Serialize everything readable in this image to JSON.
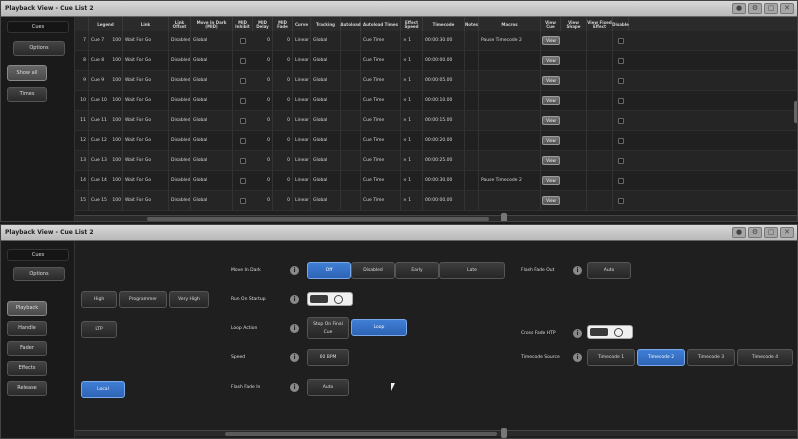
{
  "top_window": {
    "title": "Playback View - Cue List 2",
    "nav": {
      "cues": "Cues",
      "options": "Options",
      "show_all": "Show all",
      "times": "Times"
    },
    "columns": [
      "",
      "Legend",
      "Link",
      "Link Offset",
      "Move In Dark (MID)",
      "MID Inhibit",
      "MID Delay",
      "MID Fade",
      "Curve",
      "Tracking",
      "Autoload",
      "Autoload Times",
      "Effect Speed",
      "Timecode",
      "Notes",
      "Macros",
      "View Cue",
      "View Shape",
      "View Fixed Effect",
      "Disable"
    ],
    "rows": [
      {
        "n": "7",
        "legend": "Cue 7",
        "lvl": "100",
        "link": "Wait For Go",
        "offset": "Disabled",
        "mid": "Global",
        "delay": "0",
        "fade": "0",
        "curve": "Linear",
        "tracking": "Global",
        "autoload": "Cue Time",
        "speed": "× 1",
        "timecode": "00:00:30.00",
        "macros": "Pause Timecode 2",
        "view": "View"
      },
      {
        "n": "8",
        "legend": "Cue 8",
        "lvl": "100",
        "link": "Wait For Go",
        "offset": "Disabled",
        "mid": "Global",
        "delay": "0",
        "fade": "0",
        "curve": "Linear",
        "tracking": "Global",
        "autoload": "Cue Time",
        "speed": "× 1",
        "timecode": "00:00:00.00",
        "macros": "",
        "view": "View"
      },
      {
        "n": "9",
        "legend": "Cue 9",
        "lvl": "100",
        "link": "Wait For Go",
        "offset": "Disabled",
        "mid": "Global",
        "delay": "0",
        "fade": "0",
        "curve": "Linear",
        "tracking": "Global",
        "autoload": "Cue Time",
        "speed": "× 1",
        "timecode": "00:00:05.00",
        "macros": "",
        "view": "View"
      },
      {
        "n": "10",
        "legend": "Cue 10",
        "lvl": "100",
        "link": "Wait For Go",
        "offset": "Disabled",
        "mid": "Global",
        "delay": "0",
        "fade": "0",
        "curve": "Linear",
        "tracking": "Global",
        "autoload": "Cue Time",
        "speed": "× 1",
        "timecode": "00:00:10.00",
        "macros": "",
        "view": "View"
      },
      {
        "n": "11",
        "legend": "Cue 11",
        "lvl": "100",
        "link": "Wait For Go",
        "offset": "Disabled",
        "mid": "Global",
        "delay": "0",
        "fade": "0",
        "curve": "Linear",
        "tracking": "Global",
        "autoload": "Cue Time",
        "speed": "× 1",
        "timecode": "00:00:15.00",
        "macros": "",
        "view": "View"
      },
      {
        "n": "12",
        "legend": "Cue 12",
        "lvl": "100",
        "link": "Wait For Go",
        "offset": "Disabled",
        "mid": "Global",
        "delay": "0",
        "fade": "0",
        "curve": "Linear",
        "tracking": "Global",
        "autoload": "Cue Time",
        "speed": "× 1",
        "timecode": "00:00:20.00",
        "macros": "",
        "view": "View"
      },
      {
        "n": "13",
        "legend": "Cue 13",
        "lvl": "100",
        "link": "Wait For Go",
        "offset": "Disabled",
        "mid": "Global",
        "delay": "0",
        "fade": "0",
        "curve": "Linear",
        "tracking": "Global",
        "autoload": "Cue Time",
        "speed": "× 1",
        "timecode": "00:00:25.00",
        "macros": "",
        "view": "View"
      },
      {
        "n": "14",
        "legend": "Cue 14",
        "lvl": "100",
        "link": "Wait For Go",
        "offset": "Disabled",
        "mid": "Global",
        "delay": "0",
        "fade": "0",
        "curve": "Linear",
        "tracking": "Global",
        "autoload": "Cue Time",
        "speed": "× 1",
        "timecode": "00:00:30.00",
        "macros": "Pause Timecode 2",
        "view": "View"
      },
      {
        "n": "15",
        "legend": "Cue 15",
        "lvl": "100",
        "link": "Wait For Go",
        "offset": "Disabled",
        "mid": "Global",
        "delay": "0",
        "fade": "0",
        "curve": "Linear",
        "tracking": "Global",
        "autoload": "Cue Time",
        "speed": "× 1",
        "timecode": "00:00:00.00",
        "macros": "",
        "view": "View"
      }
    ]
  },
  "bottom_window": {
    "title": "Playback View - Cue List 2",
    "nav": {
      "cues": "Cues",
      "options": "Options",
      "playback": "Playback",
      "handle": "Handle",
      "fader": "Fader",
      "effects": "Effects",
      "release": "Release"
    },
    "priority": {
      "high": "High",
      "programmer": "Programmer",
      "very_high": "Very High"
    },
    "ltp": "LTP",
    "local": "Local",
    "move_in_dark": {
      "label": "Move In Dark",
      "options": [
        "Off",
        "Disabled",
        "Early",
        "Late"
      ]
    },
    "run_on_startup": {
      "label": "Run On Startup"
    },
    "loop_action": {
      "label": "Loop Action",
      "stop": "Stop On Final Cue",
      "loop": "Loop"
    },
    "speed": {
      "label": "Speed",
      "value": "60 BPM"
    },
    "flash_fade_in": {
      "label": "Flash Fade In",
      "value": "Auto"
    },
    "flash_fade_out": {
      "label": "Flash Fade Out",
      "value": "Auto"
    },
    "cross_fade_htp": {
      "label": "Cross Fade HTP"
    },
    "timecode_source": {
      "label": "Timecode Source",
      "options": [
        "Timecode 1",
        "Timecode 2",
        "Timecode 3",
        "Timecode 4"
      ]
    }
  },
  "colors": {
    "accent": "#3f7fd6"
  }
}
